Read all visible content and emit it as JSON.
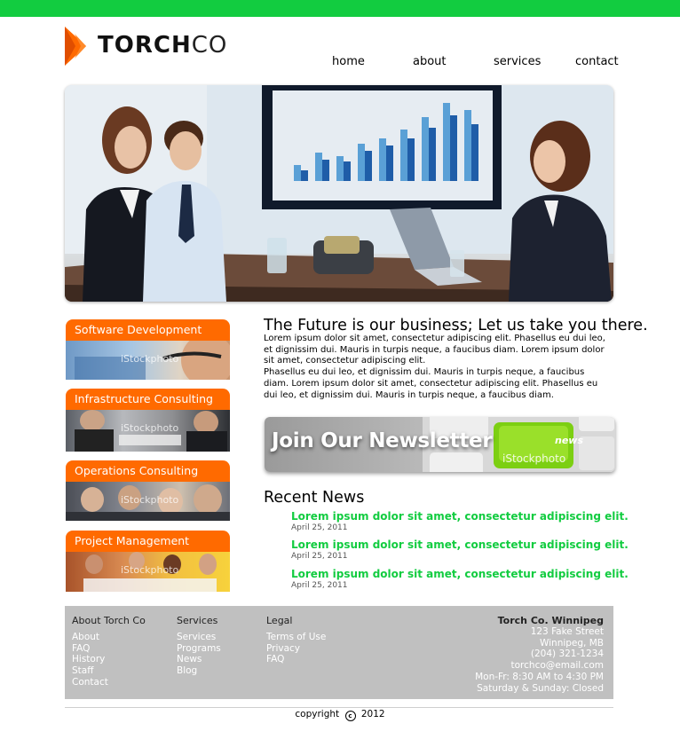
{
  "brand": {
    "name_bold": "TORCH",
    "name_light": "CO",
    "accent_green": "#12cc40",
    "accent_orange": "#ff6a00"
  },
  "nav": {
    "items": [
      "home",
      "about",
      "services",
      "contact"
    ]
  },
  "hero": {
    "image": "business-meeting-photo"
  },
  "services": [
    {
      "label": "Software Development",
      "watermark": "iStockphoto"
    },
    {
      "label": "Infrastructure Consulting",
      "watermark": "iStockphoto"
    },
    {
      "label": "Operations Consulting",
      "watermark": "iStockphoto"
    },
    {
      "label": "Project Management",
      "watermark": "iStockphoto"
    }
  ],
  "main": {
    "headline": "The Future is our business; Let us take you there.",
    "paragraph1": "Lorem ipsum dolor sit amet, consectetur adipiscing elit. Phasellus eu dui leo, et dignissim dui. Mauris in turpis neque, a faucibus diam. Lorem ipsum dolor sit amet, consectetur adipiscing elit.",
    "paragraph2": "Phasellus eu dui leo, et dignissim dui. Mauris in turpis neque, a faucibus diam. Lorem ipsum dolor sit amet, consectetur adipiscing elit. Phasellus eu dui leo, et dignissim dui. Mauris in turpis neque, a faucibus diam."
  },
  "newsletter": {
    "label": "Join Our Newsletter",
    "key_label": "news",
    "watermark": "iStockphoto"
  },
  "recent_news": {
    "title": "Recent News",
    "items": [
      {
        "title": "Lorem ipsum dolor sit amet, consectetur adipiscing elit.",
        "date": "April 25, 2011"
      },
      {
        "title": "Lorem ipsum dolor sit amet, consectetur adipiscing elit.",
        "date": "April 25, 2011"
      },
      {
        "title": "Lorem ipsum dolor sit amet, consectetur adipiscing elit.",
        "date": "April 25, 2011"
      }
    ]
  },
  "footer": {
    "col1": {
      "heading": "About Torch Co",
      "links": [
        "About",
        "FAQ",
        "History",
        "Staff",
        "Contact"
      ]
    },
    "col2": {
      "heading": "Services",
      "links": [
        "Services",
        "Programs",
        "News",
        "Blog"
      ]
    },
    "col3": {
      "heading": "Legal",
      "links": [
        "Terms of Use",
        "Privacy",
        "FAQ"
      ]
    },
    "contact": {
      "heading": "Torch Co.  Winnipeg",
      "lines": [
        "123 Fake Street",
        "Winnipeg, MB",
        "(204) 321-1234",
        "torchco@email.com",
        "Mon-Fr:  8:30 AM to 4:30 PM",
        "Saturday & Sunday:  Closed"
      ]
    },
    "copyright_prefix": "copyright",
    "copyright_symbol": "c",
    "copyright_year": "2012"
  }
}
